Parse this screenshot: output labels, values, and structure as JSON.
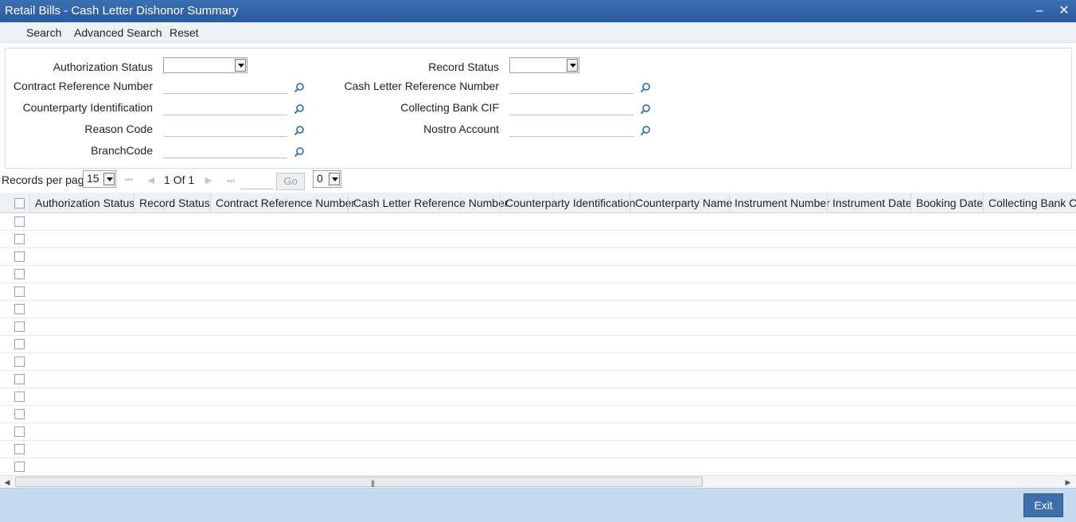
{
  "window": {
    "title": "Retail Bills - Cash Letter Dishonor Summary",
    "minimize_icon": "minimize-icon",
    "close_icon": "close-icon"
  },
  "menu": {
    "search": "Search",
    "advanced_search": "Advanced Search",
    "reset": "Reset"
  },
  "criteria": {
    "authorization_status": {
      "label": "Authorization Status",
      "value": ""
    },
    "record_status": {
      "label": "Record Status",
      "value": ""
    },
    "contract_reference_number": {
      "label": "Contract Reference Number",
      "value": ""
    },
    "cash_letter_reference_number": {
      "label": "Cash Letter Reference Number",
      "value": ""
    },
    "counterparty_identification": {
      "label": "Counterparty Identification",
      "value": ""
    },
    "collecting_bank_cif": {
      "label": "Collecting Bank CIF",
      "value": ""
    },
    "reason_code": {
      "label": "Reason Code",
      "value": ""
    },
    "nostro_account": {
      "label": "Nostro Account",
      "value": ""
    },
    "branch_code": {
      "label": "BranchCode",
      "value": ""
    }
  },
  "pager": {
    "records_per_page_label": "Records per page",
    "records_per_page": "15",
    "page": "1",
    "of_label": "Of",
    "total_pages": "1",
    "go_label": "Go",
    "page_select": "0"
  },
  "grid": {
    "columns": [
      "Authorization Status",
      "Record Status",
      "Contract Reference Number",
      "Cash Letter Reference Number",
      "Counterparty Identification",
      "Counterparty Name",
      "Instrument Number",
      "Instrument Date",
      "Booking Date",
      "Collecting Bank CIF"
    ],
    "row_count": 15
  },
  "footer": {
    "exit_label": "Exit"
  },
  "colors": {
    "title_bar": "#2f62a6",
    "footer": "#c6dbef",
    "exit_button": "#3f6fa8",
    "lookup_icon": "#3a78b5"
  }
}
